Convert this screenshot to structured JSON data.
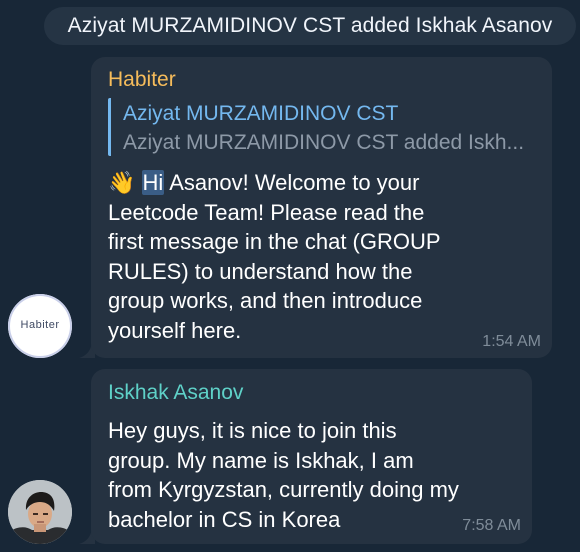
{
  "service_message": "Aziyat MURZAMIDINOV CST added Iskhak Asanov",
  "messages": [
    {
      "sender": "Habiter",
      "reply": {
        "name": "Aziyat MURZAMIDINOV CST",
        "text": "Aziyat MURZAMIDINOV CST added Iskh..."
      },
      "emoji": "👋",
      "highlight": "Hi",
      "text": " Asanov! Welcome to your\nLeetcode Team! Please read the\nfirst message in the chat (GROUP\nRULES) to understand how the\ngroup works, and then introduce\nyourself here.",
      "time": "1:54 AM",
      "avatar_text": "Habiter",
      "avatar_icon": "habiter-logo-avatar"
    },
    {
      "sender": "Iskhak Asanov",
      "text": "Hey guys, it is nice to join this\ngroup. My name is Iskhak, I am\nfrom Kyrgyzstan, currently doing my\nbachelor in CS in Korea",
      "time": "7:58 AM",
      "avatar_icon": "user-photo-avatar"
    }
  ],
  "colors": {
    "background": "#182737",
    "bubble": "#253241",
    "sender_habiter": "#f6bc5b",
    "sender_iskhak": "#5fd1c8",
    "reply_accent": "#74b8ef",
    "timestamp": "#7f8c99"
  }
}
